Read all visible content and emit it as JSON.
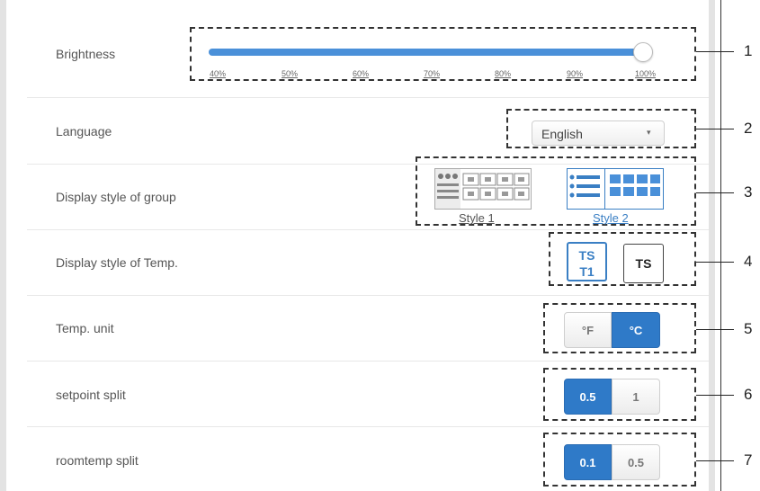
{
  "settings": {
    "brightness": {
      "label": "Brightness",
      "value_percent": 100,
      "ticks": [
        "40%",
        "50%",
        "60%",
        "70%",
        "80%",
        "90%",
        "100%"
      ]
    },
    "language": {
      "label": "Language",
      "selected": "English"
    },
    "group_style": {
      "label": "Display style of group",
      "options": [
        "Style 1",
        "Style 2"
      ],
      "selected": "Style 2"
    },
    "temp_style": {
      "label": "Display style of Temp.",
      "options": [
        {
          "line1": "TS",
          "line2": "T1"
        },
        {
          "line1": "TS",
          "line2": ""
        }
      ],
      "selected_index": 0
    },
    "temp_unit": {
      "label": "Temp. unit",
      "options": [
        "°F",
        "°C"
      ],
      "selected": "°C"
    },
    "setpoint_split": {
      "label": "setpoint split",
      "options": [
        "0.5",
        "1"
      ],
      "selected": "0.5"
    },
    "roomtemp_split": {
      "label": "roomtemp split",
      "options": [
        "0.1",
        "0.5"
      ],
      "selected": "0.1"
    }
  },
  "callouts": [
    "1",
    "2",
    "3",
    "4",
    "5",
    "6",
    "7"
  ],
  "colors": {
    "accent": "#2f7ac8",
    "slider": "#4a90d9",
    "selected_outline": "#3a7fc4"
  }
}
